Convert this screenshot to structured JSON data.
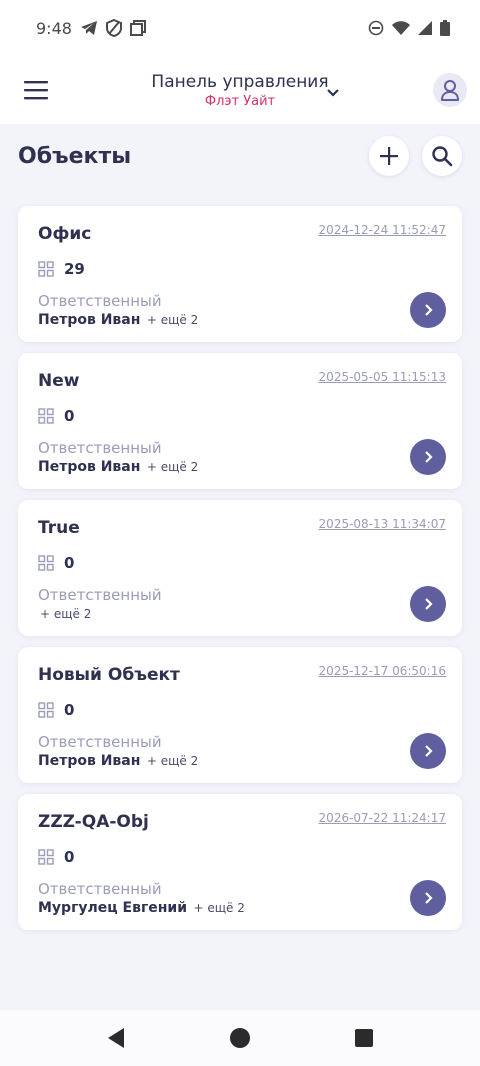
{
  "status_bar": {
    "time": "9:48",
    "icons": [
      "telegram-icon",
      "shield-icon",
      "screen-icon",
      "dnd-icon",
      "wifi-icon",
      "signal-icon",
      "battery-icon"
    ]
  },
  "header": {
    "title": "Панель управления",
    "subtitle": "Флэт Уайт"
  },
  "page": {
    "title": "Объекты"
  },
  "colors": {
    "accent": "#5f5fa0",
    "subtitle": "#d4306b",
    "background": "#f3f3fa"
  },
  "objects": [
    {
      "name": "Офис",
      "date": "2024-12-24 11:52:47",
      "count": "29",
      "resp_label": "Ответственный",
      "person": "Петров Иван",
      "more": "+ ещё 2"
    },
    {
      "name": "New",
      "date": "2025-05-05 11:15:13",
      "count": "0",
      "resp_label": "Ответственный",
      "person": "Петров Иван",
      "more": "+ ещё 2"
    },
    {
      "name": "True",
      "date": "2025-08-13 11:34:07",
      "count": "0",
      "resp_label": "Ответственный",
      "person": "",
      "more": "+ ещё 2"
    },
    {
      "name": "Новый Объект",
      "date": "2025-12-17 06:50:16",
      "count": "0",
      "resp_label": "Ответственный",
      "person": "Петров Иван",
      "more": "+ ещё 2"
    },
    {
      "name": "ZZZ-QA-Obj",
      "date": "2026-07-22 11:24:17",
      "count": "0",
      "resp_label": "Ответственный",
      "person": "Мургулец Евгений",
      "more": "+ ещё 2"
    }
  ]
}
